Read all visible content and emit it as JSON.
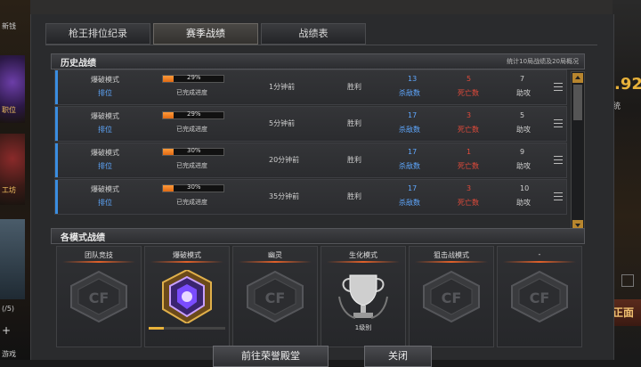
{
  "background": {
    "left_labels": [
      "新钱",
      "职位",
      "工坊",
      "(/5)",
      "游戏"
    ],
    "right_number": ".92",
    "right_sub": "统",
    "right_button": "正面"
  },
  "tabs": [
    {
      "label": "枪王排位纪录",
      "active": false
    },
    {
      "label": "赛季战绩",
      "active": true
    },
    {
      "label": "战绩表",
      "active": false
    }
  ],
  "history": {
    "title": "历史战绩",
    "right_text": "统计10局战绩及20局概况",
    "rows": [
      {
        "mode": "爆破模式",
        "sub": "排位",
        "progress": 29,
        "progress_label": "29%",
        "progress_sub": "已完成进度",
        "time": "1分钟前",
        "result": "胜利",
        "kills": "13",
        "kills_label": "杀敌数",
        "deaths": "5",
        "deaths_label": "死亡数",
        "assists": "7",
        "assists_label": "助攻"
      },
      {
        "mode": "爆破模式",
        "sub": "排位",
        "progress": 29,
        "progress_label": "29%",
        "progress_sub": "已完成进度",
        "time": "5分钟前",
        "result": "胜利",
        "kills": "17",
        "kills_label": "杀敌数",
        "deaths": "3",
        "deaths_label": "死亡数",
        "assists": "5",
        "assists_label": "助攻"
      },
      {
        "mode": "爆破模式",
        "sub": "排位",
        "progress": 30,
        "progress_label": "30%",
        "progress_sub": "已完成进度",
        "time": "20分钟前",
        "result": "胜利",
        "kills": "17",
        "kills_label": "杀敌数",
        "deaths": "1",
        "deaths_label": "死亡数",
        "assists": "9",
        "assists_label": "助攻"
      },
      {
        "mode": "爆破模式",
        "sub": "排位",
        "progress": 30,
        "progress_label": "30%",
        "progress_sub": "已完成进度",
        "time": "35分钟前",
        "result": "胜利",
        "kills": "17",
        "kills_label": "杀敌数",
        "deaths": "3",
        "deaths_label": "死亡数",
        "assists": "10",
        "assists_label": "助攻"
      }
    ]
  },
  "modes": {
    "title": "各模式战绩",
    "items": [
      {
        "name": "团队竞技",
        "icon": "cf-logo",
        "foot": ""
      },
      {
        "name": "爆破模式",
        "icon": "rank-emblem",
        "foot": ""
      },
      {
        "name": "幽灵",
        "icon": "cf-logo",
        "foot": ""
      },
      {
        "name": "生化模式",
        "icon": "trophy",
        "foot": "1级别"
      },
      {
        "name": "狙击战模式",
        "icon": "cf-logo",
        "foot": ""
      },
      {
        "name": "-",
        "icon": "cf-logo",
        "foot": ""
      }
    ]
  },
  "buttons": {
    "hall": "前往荣誉殿堂",
    "close": "关闭"
  },
  "colors": {
    "accent_blue": "#3a8de0",
    "bar_orange": "#f08a2a",
    "kills_blue": "#5fa8ff",
    "deaths_red": "#e44b3b"
  }
}
